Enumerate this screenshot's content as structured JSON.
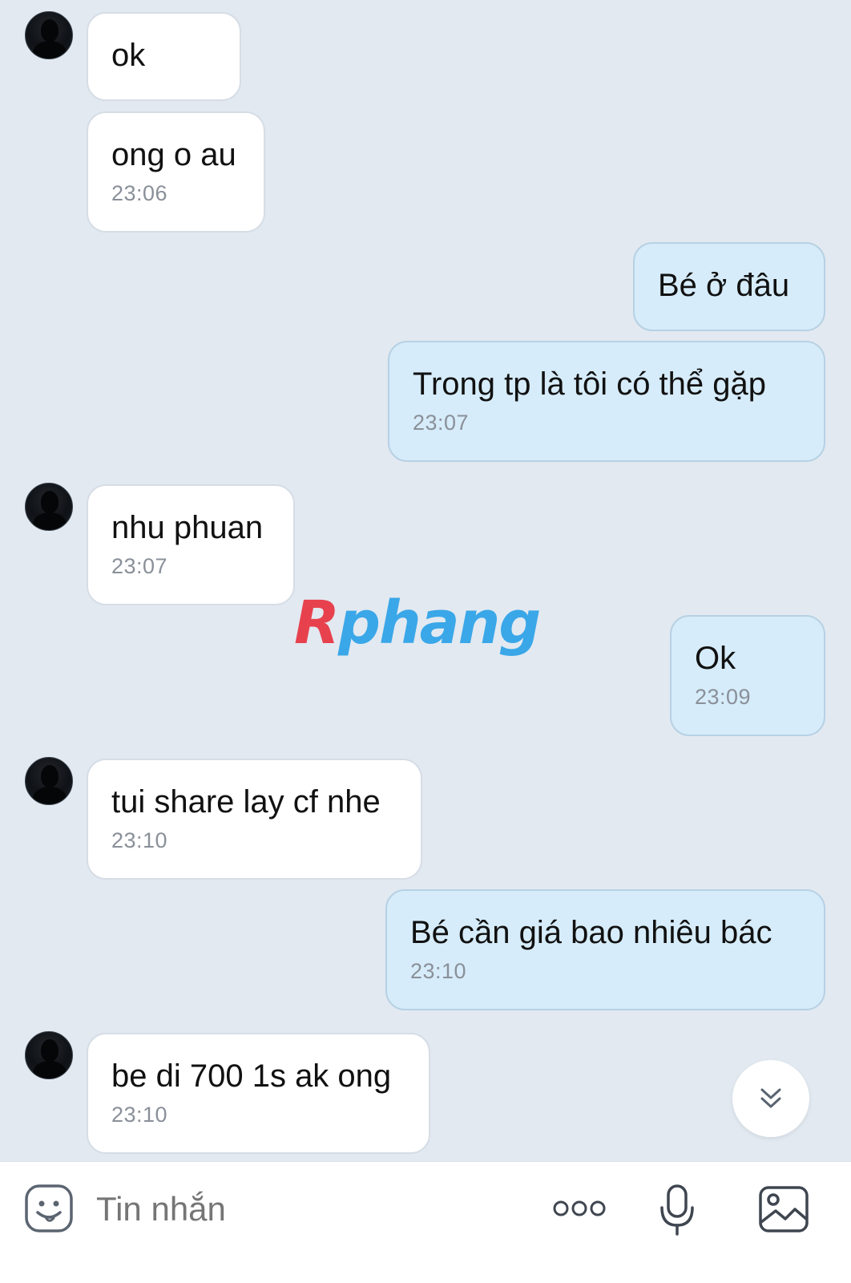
{
  "messages": [
    {
      "text": "ok",
      "time": ""
    },
    {
      "text": "ong o au",
      "time": "23:06"
    },
    {
      "text": "Bé ở đâu",
      "time": ""
    },
    {
      "text": "Trong tp là tôi có thể gặp",
      "time": "23:07"
    },
    {
      "text": "nhu phuan",
      "time": "23:07"
    },
    {
      "text": "Ok",
      "time": "23:09"
    },
    {
      "text": "tui share lay cf nhe",
      "time": "23:10"
    },
    {
      "text": "Bé cần giá bao nhiêu bác",
      "time": "23:10"
    },
    {
      "text": "be di 700 1s ak ong",
      "time": "23:10"
    }
  ],
  "watermark": {
    "part1": "R",
    "part2": "phang"
  },
  "composer": {
    "placeholder": "Tin nhắn"
  },
  "icons": {
    "sticker": "sticker-icon",
    "more": "more-dots-icon",
    "mic": "microphone-icon",
    "image": "image-icon",
    "scroll_down": "double-chevron-down-icon"
  },
  "colors": {
    "background": "#e2e9f1",
    "incoming_bubble": "#ffffff",
    "outgoing_bubble": "#d6ecfa",
    "time_text": "#8a9099",
    "watermark_red": "#e8414e",
    "watermark_blue": "#3aa7e8"
  }
}
